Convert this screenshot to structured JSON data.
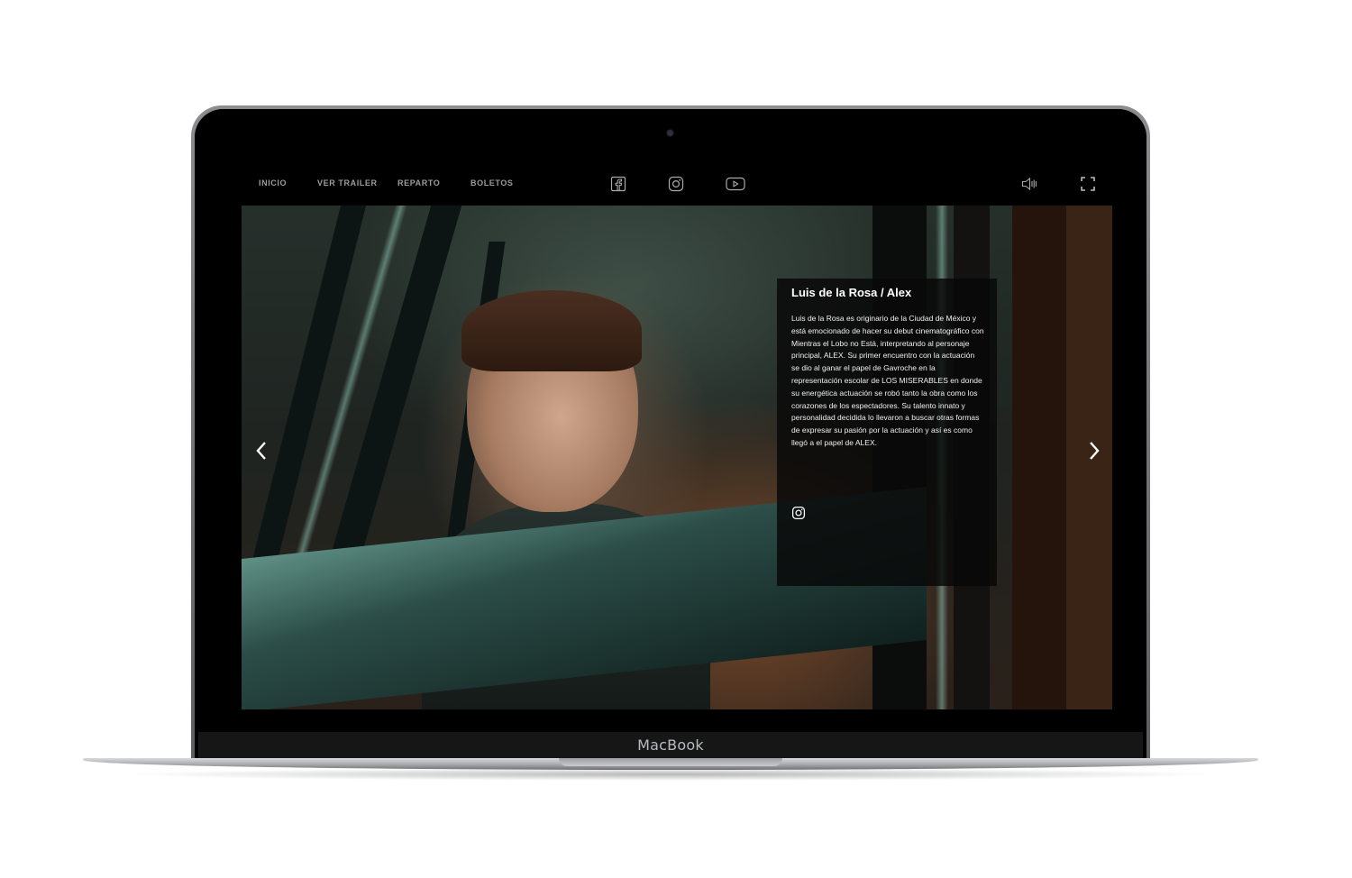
{
  "device": {
    "brand_label": "MacBook"
  },
  "nav": {
    "links": [
      "INICIO",
      "VER TRAILER",
      "REPARTO",
      "BOLETOS"
    ],
    "social_icons": [
      "facebook-icon",
      "instagram-icon",
      "youtube-icon"
    ],
    "controls": [
      "volume-icon",
      "fullscreen-icon"
    ]
  },
  "cast_card": {
    "title": "Luis de la Rosa / Alex",
    "bio": "Luis de la Rosa es originario de la Ciudad de México y está emocionado de hacer su debut cinematográfico con Mientras el Lobo no Está, interpretando al personaje principal, ALEX. Su primer encuentro con la actuación se dio al ganar el papel de Gavroche en la representación escolar de LOS MISERABLES en donde su energética actuación se robó tanto la obra como los corazones de los espectadores. Su talento innato y personalidad decidida lo llevaron a buscar otras formas de expresar su pasión por la actuación y así es como llegó a el papel de ALEX.",
    "social_icon": "instagram-icon"
  },
  "carousel": {
    "prev_icon": "chevron-left-icon",
    "next_icon": "chevron-right-icon"
  },
  "colors": {
    "screen_bg": "#000000",
    "nav_text": "#9c9c9c",
    "card_bg": "rgba(8,8,8,0.84)"
  }
}
